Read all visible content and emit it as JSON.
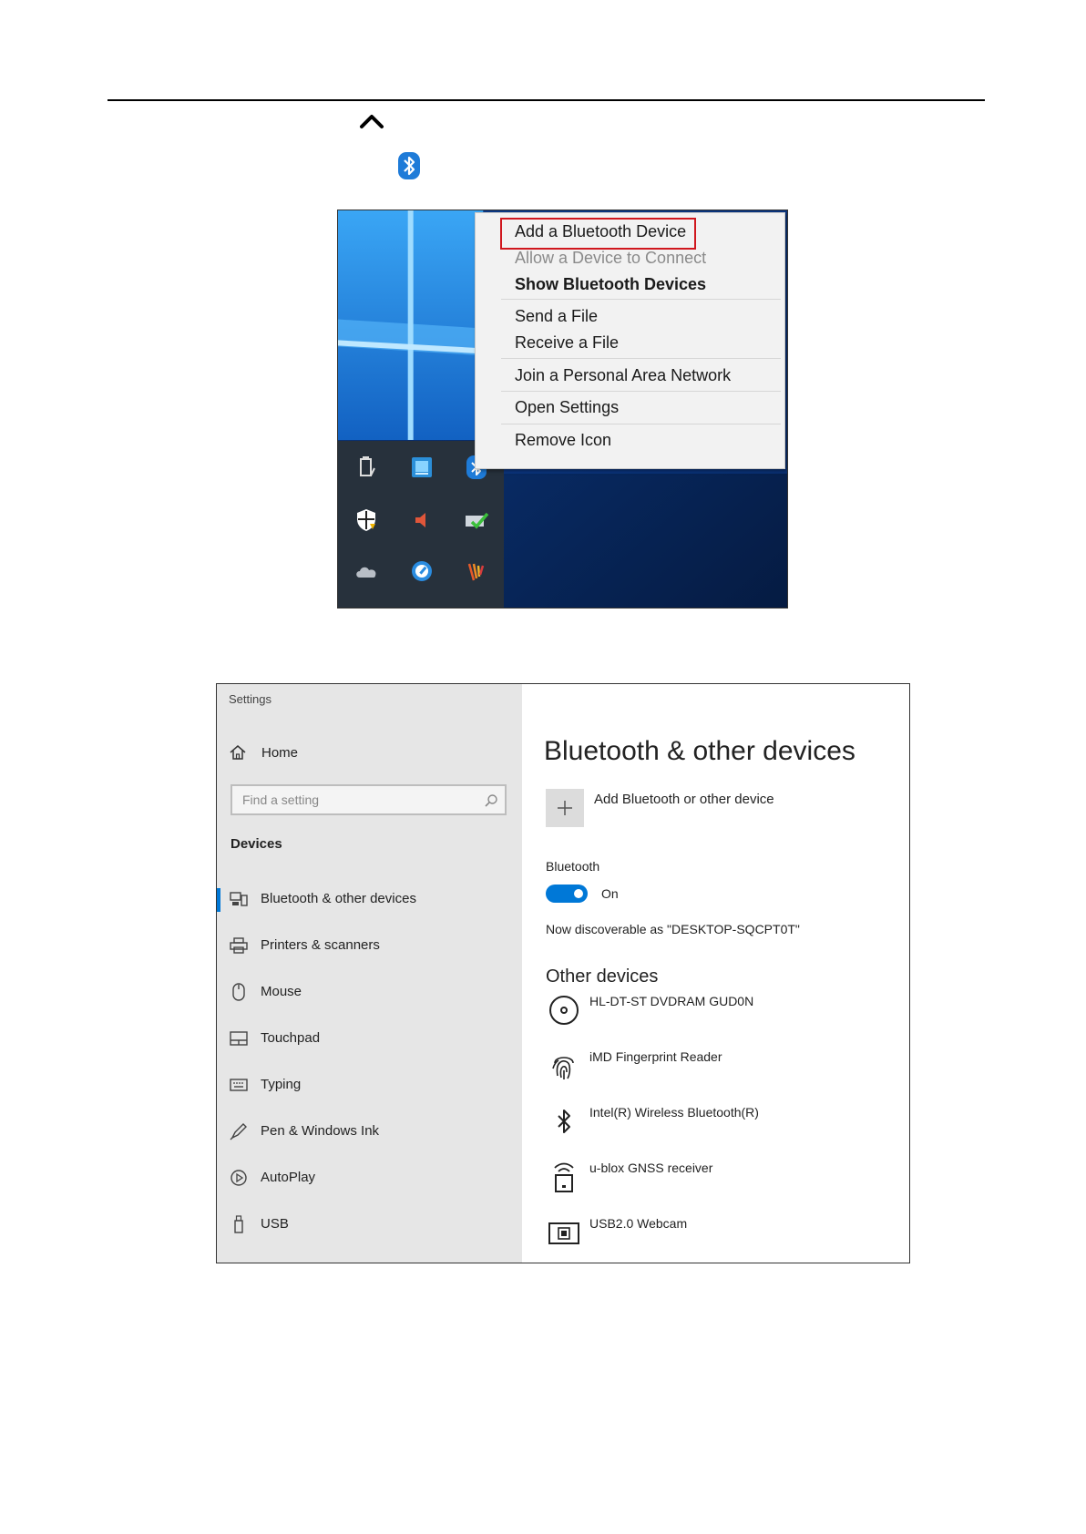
{
  "context_menu": {
    "items": [
      "Add a Bluetooth Device",
      "Allow a Device to Connect",
      "Show Bluetooth Devices",
      "Send a File",
      "Receive a File",
      "Join a Personal Area Network",
      "Open Settings",
      "Remove Icon"
    ],
    "highlight_color": "#d0171e"
  },
  "settings": {
    "window_title": "Settings",
    "sidebar": {
      "home_label": "Home",
      "search_placeholder": "Find a setting",
      "section_heading": "Devices",
      "items": [
        {
          "label": "Bluetooth & other devices",
          "icon": "bluetooth-devices-icon",
          "selected": true
        },
        {
          "label": "Printers & scanners",
          "icon": "printer-icon"
        },
        {
          "label": "Mouse",
          "icon": "mouse-icon"
        },
        {
          "label": "Touchpad",
          "icon": "touchpad-icon"
        },
        {
          "label": "Typing",
          "icon": "keyboard-icon"
        },
        {
          "label": "Pen & Windows Ink",
          "icon": "pen-icon"
        },
        {
          "label": "AutoPlay",
          "icon": "autoplay-icon"
        },
        {
          "label": "USB",
          "icon": "usb-icon"
        }
      ]
    },
    "main": {
      "title": "Bluetooth & other devices",
      "add_device_label": "Add Bluetooth or other device",
      "bluetooth_label": "Bluetooth",
      "toggle_state": "On",
      "discoverable_text": "Now discoverable as \"DESKTOP-SQCPT0T\"",
      "other_devices_heading": "Other devices",
      "devices": [
        {
          "name": "HL-DT-ST DVDRAM GUD0N",
          "icon": "disc-drive-icon"
        },
        {
          "name": "iMD Fingerprint Reader",
          "icon": "fingerprint-icon"
        },
        {
          "name": "Intel(R) Wireless Bluetooth(R)",
          "icon": "bluetooth-icon"
        },
        {
          "name": "u-blox GNSS receiver",
          "icon": "gnss-receiver-icon"
        },
        {
          "name": "USB2.0 Webcam",
          "icon": "webcam-icon"
        }
      ]
    },
    "accent_color": "#0078d7"
  }
}
